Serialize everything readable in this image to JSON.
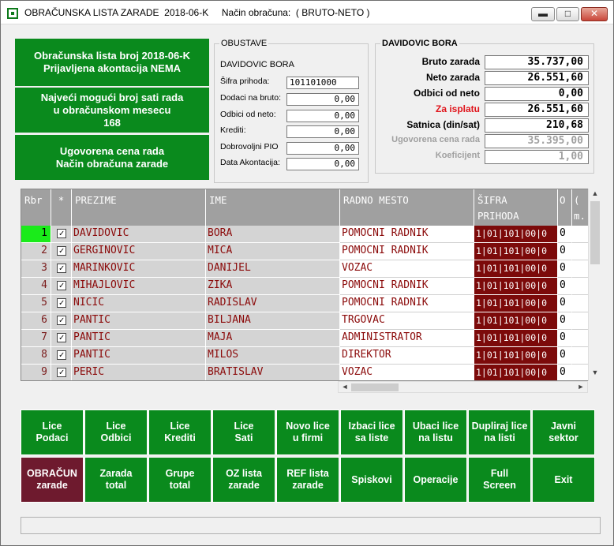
{
  "window": {
    "title": "OBRAČUNSKA LISTA ZARADE  2018-06-K     Način obračuna:  ( BRUTO-NETO )",
    "min_glyph": "▬",
    "max_glyph": "□",
    "close_glyph": "✕"
  },
  "info": {
    "box1_line1": "Obračunska lista broj  2018-06-K",
    "box1_line2": "Prijavljena akontacija NEMA",
    "box2_line1": "Najveći mogući broj sati rada",
    "box2_line2": "u obračunskom mesecu",
    "box2_line3": "168",
    "box3_line1": "Ugovorena cena rada",
    "box3_line2": "Način obračuna zarade"
  },
  "obustave": {
    "legend": "OBUSTAVE",
    "name": "DAVIDOVIC BORA",
    "sifra_label": "Šifra prihoda:",
    "sifra_value": "101101000",
    "dodaci_label": "Dodaci na bruto:",
    "dodaci_value": "0,00",
    "odbici_label": "Odbici od neto:",
    "odbici_value": "0,00",
    "krediti_label": "Krediti:",
    "krediti_value": "0,00",
    "pio_label": "Dobrovoljni PIO",
    "pio_value": "0,00",
    "akont_label": "Data Akontacija:",
    "akont_value": "0,00"
  },
  "employee": {
    "legend": "DAVIDOVIC BORA",
    "bruto_label": "Bruto zarada",
    "bruto_value": "35.737,00",
    "neto_label": "Neto zarada",
    "neto_value": "26.551,60",
    "odbici_label": "Odbici od neto",
    "odbici_value": "0,00",
    "isplata_label": "Za isplatu",
    "isplata_value": "26.551,60",
    "satnica_label": "Satnica (din/sat)",
    "satnica_value": "210,68",
    "ugovorena_label": "Ugovorena cena rada",
    "ugovorena_value": "35.395,00",
    "koef_label": "Koeficijent",
    "koef_value": "1,00"
  },
  "grid": {
    "headers": {
      "rbr": "Rbr",
      "star": "*",
      "prezime": "PREZIME",
      "ime": "IME",
      "mesto": "RADNO MESTO",
      "sifra1": "ŠIFRA",
      "sifra2": "PRIHODA",
      "o": "O",
      "m1": "(",
      "m2": "m."
    },
    "rows": [
      {
        "rbr": "1",
        "prezime": "DAVIDOVIC",
        "ime": "BORA",
        "mesto": "POMOCNI RADNIK",
        "sifra": "1|01|101|00|0",
        "o": "0"
      },
      {
        "rbr": "2",
        "prezime": "GERGINOVIC",
        "ime": "MICA",
        "mesto": "POMOCNI RADNIK",
        "sifra": "1|01|101|00|0",
        "o": "0"
      },
      {
        "rbr": "3",
        "prezime": "MARINKOVIC",
        "ime": "DANIJEL",
        "mesto": "VOZAC",
        "sifra": "1|01|101|00|0",
        "o": "0"
      },
      {
        "rbr": "4",
        "prezime": "MIHAJLOVIC",
        "ime": "ZIKA",
        "mesto": "POMOCNI RADNIK",
        "sifra": "1|01|101|00|0",
        "o": "0"
      },
      {
        "rbr": "5",
        "prezime": "NICIC",
        "ime": "RADISLAV",
        "mesto": "POMOCNI RADNIK",
        "sifra": "1|01|101|00|0",
        "o": "0"
      },
      {
        "rbr": "6",
        "prezime": "PANTIC",
        "ime": "BILJANA",
        "mesto": "TRGOVAC",
        "sifra": "1|01|101|00|0",
        "o": "0"
      },
      {
        "rbr": "7",
        "prezime": "PANTIC",
        "ime": "MAJA",
        "mesto": "ADMINISTRATOR",
        "sifra": "1|01|101|00|0",
        "o": "0"
      },
      {
        "rbr": "8",
        "prezime": "PANTIC",
        "ime": "MILOS",
        "mesto": "DIREKTOR",
        "sifra": "1|01|101|00|0",
        "o": "0"
      },
      {
        "rbr": "9",
        "prezime": "PERIC",
        "ime": "BRATISLAV",
        "mesto": "VOZAC",
        "sifra": "1|01|101|00|0",
        "o": "0"
      }
    ],
    "check_glyph": "✓",
    "up_glyph": "▲",
    "down_glyph": "▼",
    "left_glyph": "◄",
    "right_glyph": "►"
  },
  "buttons": {
    "row1": [
      {
        "l1": "Lice",
        "l2": "Podaci"
      },
      {
        "l1": "Lice",
        "l2": "Odbici"
      },
      {
        "l1": "Lice",
        "l2": "Krediti"
      },
      {
        "l1": "Lice",
        "l2": "Sati"
      },
      {
        "l1": "Novo lice",
        "l2": "u firmi"
      },
      {
        "l1": "Izbaci lice",
        "l2": "sa liste"
      },
      {
        "l1": "Ubaci lice",
        "l2": "na listu"
      },
      {
        "l1": "Dupliraj lice",
        "l2": "na listi"
      },
      {
        "l1": "Javni",
        "l2": "sektor"
      }
    ],
    "row2": [
      {
        "l1": "OBRAČUN",
        "l2": "zarade"
      },
      {
        "l1": "Zarada",
        "l2": "total"
      },
      {
        "l1": "Grupe",
        "l2": "total"
      },
      {
        "l1": "OZ lista",
        "l2": "zarade"
      },
      {
        "l1": "REF lista",
        "l2": "zarade"
      },
      {
        "l1": "Spiskovi",
        "l2": ""
      },
      {
        "l1": "Operacije",
        "l2": ""
      },
      {
        "l1": "Full",
        "l2": "Screen"
      },
      {
        "l1": "Exit",
        "l2": ""
      }
    ]
  }
}
